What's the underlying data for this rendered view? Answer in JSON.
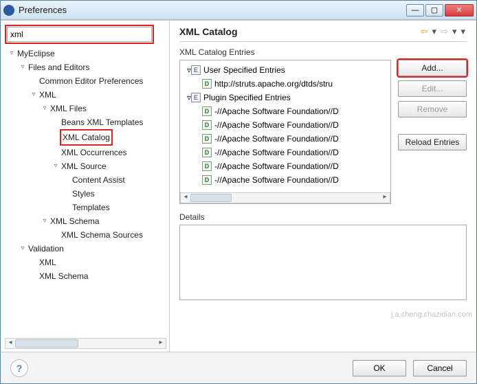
{
  "window": {
    "title": "Preferences"
  },
  "search": {
    "value": "xml"
  },
  "tree": [
    {
      "level": 0,
      "arrow": "▿",
      "label": "MyEclipse"
    },
    {
      "level": 1,
      "arrow": "▿",
      "label": "Files and Editors"
    },
    {
      "level": 2,
      "arrow": "",
      "label": "Common Editor Preferences"
    },
    {
      "level": 2,
      "arrow": "▿",
      "label": "XML"
    },
    {
      "level": 3,
      "arrow": "▿",
      "label": "XML Files"
    },
    {
      "level": 4,
      "arrow": "",
      "label": "Beans XML Templates"
    },
    {
      "level": 4,
      "arrow": "",
      "label": "XML Catalog",
      "highlight": true
    },
    {
      "level": 4,
      "arrow": "",
      "label": "XML Occurrences"
    },
    {
      "level": 4,
      "arrow": "▿",
      "label": "XML Source"
    },
    {
      "level": 5,
      "arrow": "",
      "label": "Content Assist"
    },
    {
      "level": 5,
      "arrow": "",
      "label": "Styles"
    },
    {
      "level": 5,
      "arrow": "",
      "label": "Templates"
    },
    {
      "level": 3,
      "arrow": "▿",
      "label": "XML Schema"
    },
    {
      "level": 4,
      "arrow": "",
      "label": "XML Schema Sources"
    },
    {
      "level": 1,
      "arrow": "▿",
      "label": "Validation"
    },
    {
      "level": 2,
      "arrow": "",
      "label": "XML"
    },
    {
      "level": 2,
      "arrow": "",
      "label": "XML Schema"
    }
  ],
  "page": {
    "title": "XML Catalog",
    "entries_label": "XML Catalog Entries",
    "details_label": "Details"
  },
  "entries": [
    {
      "level": 0,
      "arrow": "▿",
      "icon": "E",
      "label": "User Specified Entries"
    },
    {
      "level": 1,
      "arrow": "",
      "icon": "D",
      "label": "http://struts.apache.org/dtds/stru"
    },
    {
      "level": 0,
      "arrow": "▿",
      "icon": "E",
      "label": "Plugin Specified Entries"
    },
    {
      "level": 1,
      "arrow": "",
      "icon": "D",
      "label": "-//Apache Software Foundation//D"
    },
    {
      "level": 1,
      "arrow": "",
      "icon": "D",
      "label": "-//Apache Software Foundation//D"
    },
    {
      "level": 1,
      "arrow": "",
      "icon": "D",
      "label": "-//Apache Software Foundation//D"
    },
    {
      "level": 1,
      "arrow": "",
      "icon": "D",
      "label": "-//Apache Software Foundation//D"
    },
    {
      "level": 1,
      "arrow": "",
      "icon": "D",
      "label": "-//Apache Software Foundation//D"
    },
    {
      "level": 1,
      "arrow": "",
      "icon": "D",
      "label": "-//Apache Software Foundation//D"
    }
  ],
  "buttons": {
    "add": "Add...",
    "edit": "Edit...",
    "remove": "Remove",
    "reload": "Reload Entries",
    "ok": "OK",
    "cancel": "Cancel"
  },
  "watermark": "j.a.cheng.chazidian.com"
}
